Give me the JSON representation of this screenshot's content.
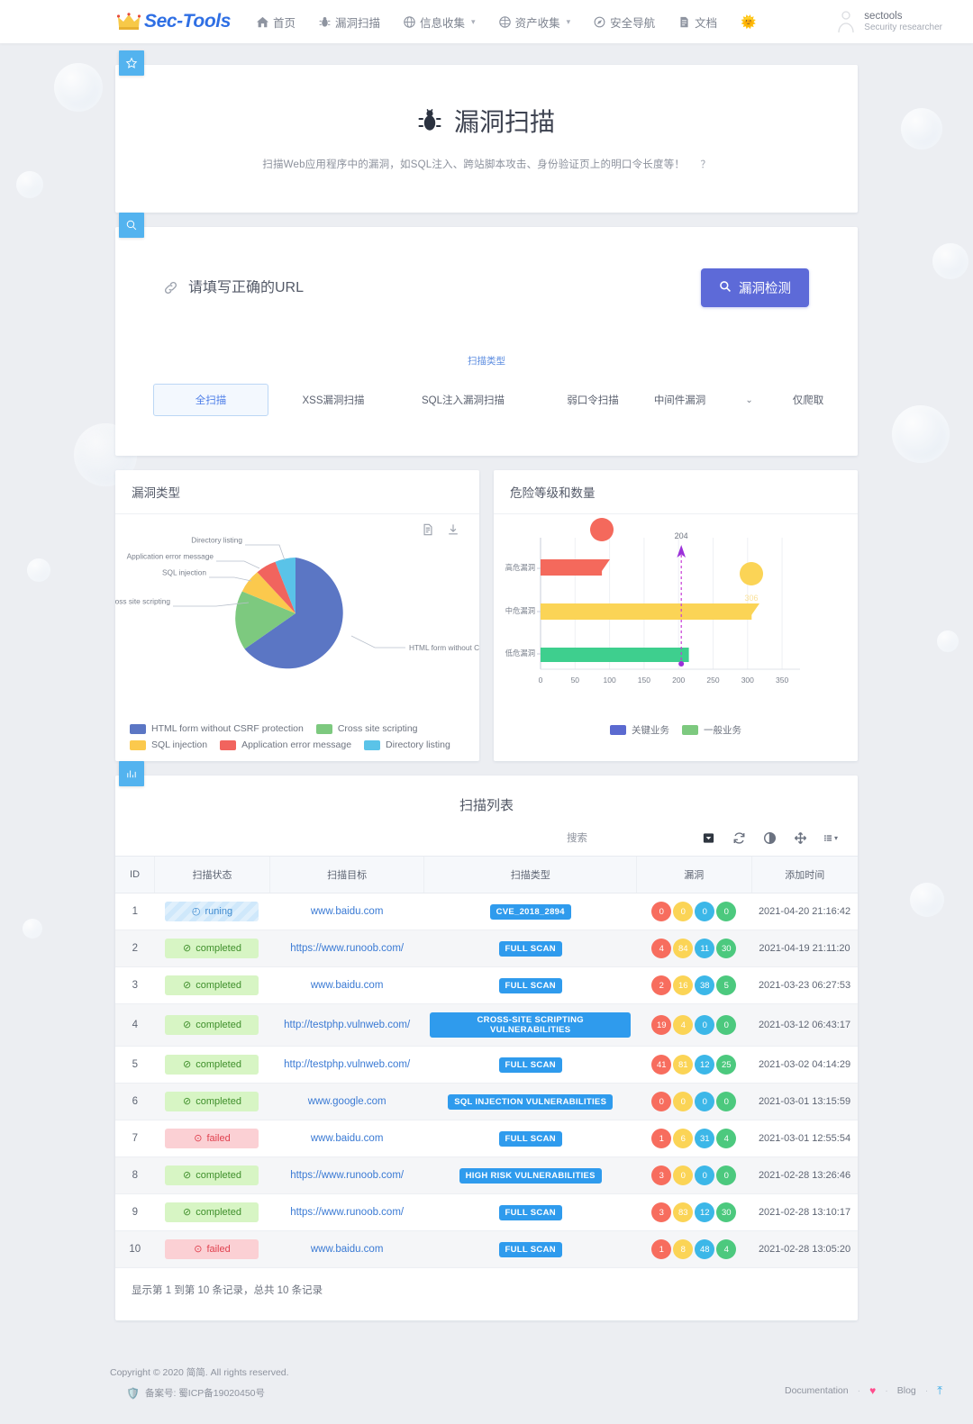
{
  "nav": {
    "brand": "Sec-Tools",
    "items": [
      {
        "label": "首页",
        "icon": "home-icon",
        "caret": false
      },
      {
        "label": "漏洞扫描",
        "icon": "bug-icon",
        "caret": false
      },
      {
        "label": "信息收集",
        "icon": "globe-icon",
        "caret": true
      },
      {
        "label": "资产收集",
        "icon": "network-icon",
        "caret": true
      },
      {
        "label": "安全导航",
        "icon": "compass-icon",
        "caret": false
      },
      {
        "label": "文档",
        "icon": "doc-icon",
        "caret": false
      },
      {
        "label": "",
        "icon": "sun-emoji-icon",
        "caret": false
      }
    ],
    "user": {
      "name": "sectools",
      "role": "Security researcher",
      "avatar_icon": "user-avatar-icon"
    }
  },
  "hero": {
    "badge_icon": "star-icon",
    "title_icon": "bug-icon",
    "title": "漏洞扫描",
    "subtitle": "扫描Web应用程序中的漏洞，如SQL注入、跨站脚本攻击、身份验证页上的明口令长度等！",
    "help": "？"
  },
  "scan": {
    "badge_icon": "search-icon",
    "url_placeholder": "请填写正确的URL",
    "url_value": "",
    "link_icon": "link-icon",
    "detect_button": "漏洞检测",
    "detect_icon": "search-icon",
    "type_label": "扫描类型",
    "types": [
      {
        "label": "全扫描",
        "active": true
      },
      {
        "label": "XSS漏洞扫描",
        "active": false
      },
      {
        "label": "SQL注入漏洞扫描",
        "active": false
      },
      {
        "label": "弱口令扫描",
        "active": false
      }
    ],
    "select_value": "中间件漏洞",
    "crawl_only": "仅爬取"
  },
  "chart_data": [
    {
      "type": "pie",
      "title": "漏洞类型",
      "labels": [
        "HTML form without CSRF protection",
        "Cross site scripting",
        "SQL injection",
        "Application error message",
        "Directory listing"
      ],
      "values": [
        68,
        15,
        8,
        5,
        4
      ],
      "colors": [
        "#5b76c4",
        "#7dc97f",
        "#fbc94d",
        "#f1645e",
        "#5ac3e8"
      ],
      "callouts": [
        "HTML form without CS...",
        "Cross site scripting",
        "SQL injection",
        "Application error message",
        "Directory listing"
      ],
      "legend_position": "bottom",
      "tools": [
        "document-icon",
        "download-icon"
      ]
    },
    {
      "type": "bar",
      "orientation": "horizontal",
      "title": "危险等级和数量",
      "categories": [
        "高危漏洞",
        "中危漏洞",
        "低危漏洞"
      ],
      "values": [
        89,
        306,
        215
      ],
      "value_labels": [
        "89",
        "306",
        ""
      ],
      "colors": [
        "#f4695c",
        "#fbd456",
        "#3ecf8e"
      ],
      "xlim": [
        0,
        350
      ],
      "xticks": [
        "0",
        "50",
        "100",
        "150",
        "200",
        "250",
        "300",
        "350"
      ],
      "marker": {
        "value": 204,
        "label": "204",
        "color": "#c63bd6"
      },
      "legend": [
        {
          "label": "关键业务",
          "color": "#5b6ad0"
        },
        {
          "label": "一般业务",
          "color": "#7dc97f"
        }
      ],
      "legend_position": "bottom"
    }
  ],
  "table": {
    "badge_icon": "chart-icon",
    "title": "扫描列表",
    "search_placeholder": "搜索",
    "toolbar_icons": [
      "export-dropdown-icon",
      "refresh-icon",
      "toggle-icon",
      "fullscreen-icon",
      "columns-icon"
    ],
    "columns": [
      "ID",
      "扫描状态",
      "扫描目标",
      "扫描类型",
      "漏洞",
      "添加时间"
    ],
    "rows": [
      {
        "id": "1",
        "status": "runing",
        "status_kind": "running",
        "target": "www.baidu.com",
        "type": "CVE_2018_2894",
        "vulns": [
          "0",
          "0",
          "0",
          "0"
        ],
        "time": "2021-04-20 21:16:42"
      },
      {
        "id": "2",
        "status": "completed",
        "status_kind": "completed",
        "target": "https://www.runoob.com/",
        "type": "FULL SCAN",
        "vulns": [
          "4",
          "84",
          "11",
          "30"
        ],
        "time": "2021-04-19 21:11:20"
      },
      {
        "id": "3",
        "status": "completed",
        "status_kind": "completed",
        "target": "www.baidu.com",
        "type": "FULL SCAN",
        "vulns": [
          "2",
          "16",
          "38",
          "5"
        ],
        "time": "2021-03-23 06:27:53"
      },
      {
        "id": "4",
        "status": "completed",
        "status_kind": "completed",
        "target": "http://testphp.vulnweb.com/",
        "type": "CROSS-SITE SCRIPTING VULNERABILITIES",
        "vulns": [
          "19",
          "4",
          "0",
          "0"
        ],
        "time": "2021-03-12 06:43:17"
      },
      {
        "id": "5",
        "status": "completed",
        "status_kind": "completed",
        "target": "http://testphp.vulnweb.com/",
        "type": "FULL SCAN",
        "vulns": [
          "41",
          "81",
          "12",
          "25"
        ],
        "time": "2021-03-02 04:14:29"
      },
      {
        "id": "6",
        "status": "completed",
        "status_kind": "completed",
        "target": "www.google.com",
        "type": "SQL INJECTION VULNERABILITIES",
        "vulns": [
          "0",
          "0",
          "0",
          "0"
        ],
        "time": "2021-03-01 13:15:59"
      },
      {
        "id": "7",
        "status": "failed",
        "status_kind": "failed",
        "target": "www.baidu.com",
        "type": "FULL SCAN",
        "vulns": [
          "1",
          "6",
          "31",
          "4"
        ],
        "time": "2021-03-01 12:55:54"
      },
      {
        "id": "8",
        "status": "completed",
        "status_kind": "completed",
        "target": "https://www.runoob.com/",
        "type": "HIGH RISK VULNERABILITIES",
        "vulns": [
          "3",
          "0",
          "0",
          "0"
        ],
        "time": "2021-02-28 13:26:46"
      },
      {
        "id": "9",
        "status": "completed",
        "status_kind": "completed",
        "target": "https://www.runoob.com/",
        "type": "FULL SCAN",
        "vulns": [
          "3",
          "83",
          "12",
          "30"
        ],
        "time": "2021-02-28 13:10:17"
      },
      {
        "id": "10",
        "status": "failed",
        "status_kind": "failed",
        "target": "www.baidu.com",
        "type": "FULL SCAN",
        "vulns": [
          "1",
          "8",
          "48",
          "4"
        ],
        "time": "2021-02-28 13:05:20"
      }
    ],
    "pagination": "显示第 1 到第 10 条记录，总共 10 条记录"
  },
  "footer": {
    "copyright": "Copyright © 2020 简简. All rights reserved.",
    "icp": "备案号: 蜀ICP备19020450号",
    "links": [
      "Documentation",
      "Blog"
    ],
    "heart_icon": "heart-icon",
    "totop_icon": "to-top-icon"
  }
}
